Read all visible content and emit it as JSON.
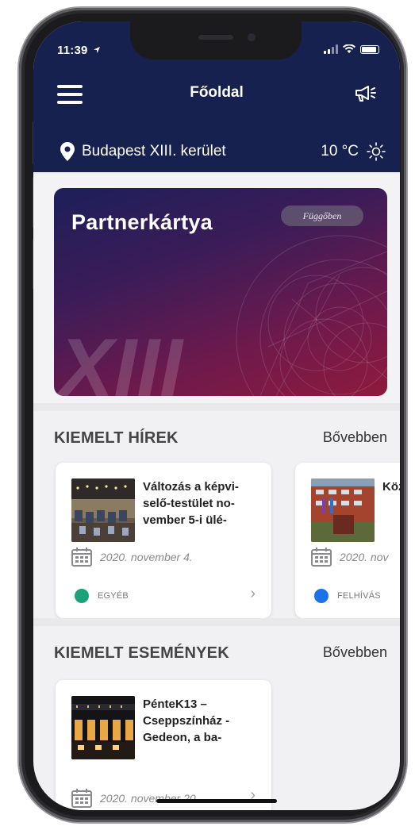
{
  "status_bar": {
    "time": "11:39"
  },
  "header": {
    "title": "Főoldal"
  },
  "location": {
    "name": "Budapest XIII. kerület",
    "temperature": "10 °C"
  },
  "partner_card": {
    "title": "Partnerkártya",
    "status": "Függőben",
    "emblem": "XIII"
  },
  "featured_news": {
    "heading": "KIEMELT HÍREK",
    "more_label": "Bővebben",
    "items": [
      {
        "title": "Változás a képvi-selő-testület no-vember 5-i ülé-",
        "date": "2020. november 4.",
        "category": "EGYÉB",
        "category_color": "#1aa37a"
      },
      {
        "title": "Köz dec",
        "date": "2020. nov",
        "category": "FELHÍVÁS",
        "category_color": "#1a73e8"
      }
    ]
  },
  "featured_events": {
    "heading": "KIEMELT ESEMÉNYEK",
    "more_label": "Bővebben",
    "items": [
      {
        "title": "PénteK13 – Cseppszínház - Gedeon, a ba-",
        "date": "2020. november 20."
      }
    ]
  },
  "colors": {
    "header_bg": "#16214f",
    "card_gradient_start": "#1d1f5a",
    "card_gradient_end": "#8e1a3c"
  }
}
